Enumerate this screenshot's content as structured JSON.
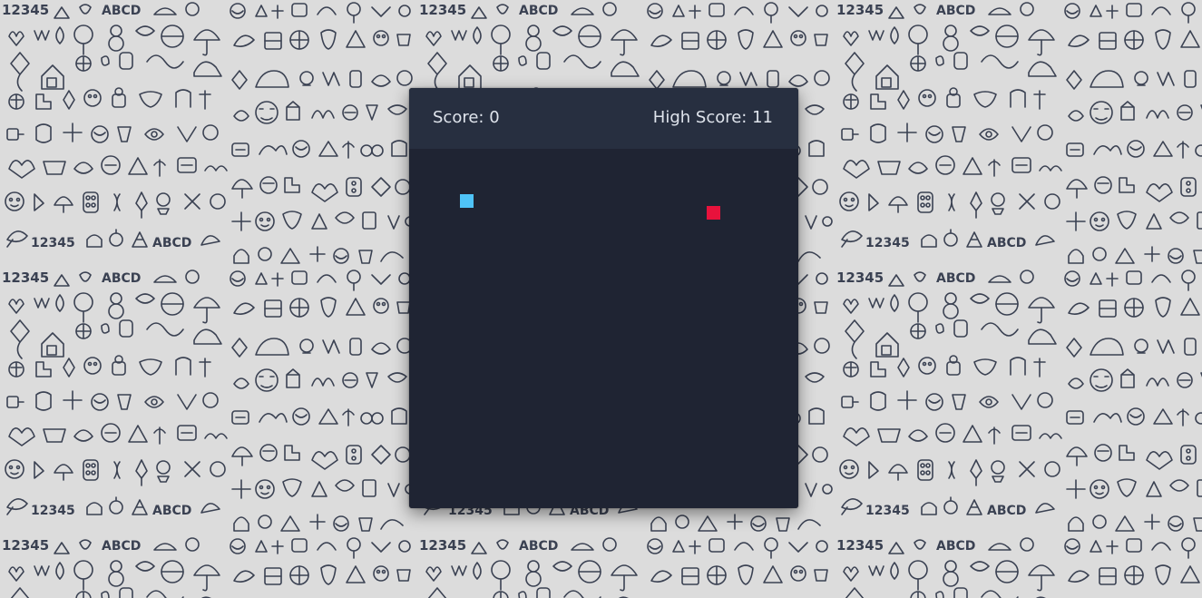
{
  "background": {
    "pattern_text_1": "12345",
    "pattern_text_2": "ABCD",
    "color": "#dcdcdc",
    "ink_color": "#3a4152"
  },
  "game": {
    "score_text": "Score: 0",
    "high_score_text": "High Score: 11",
    "score": 0,
    "high_score": 11,
    "snake_color": "#4fc3f7",
    "food_color": "#e8123c",
    "panel_color": "#1f2433",
    "header_color": "#272f40"
  }
}
